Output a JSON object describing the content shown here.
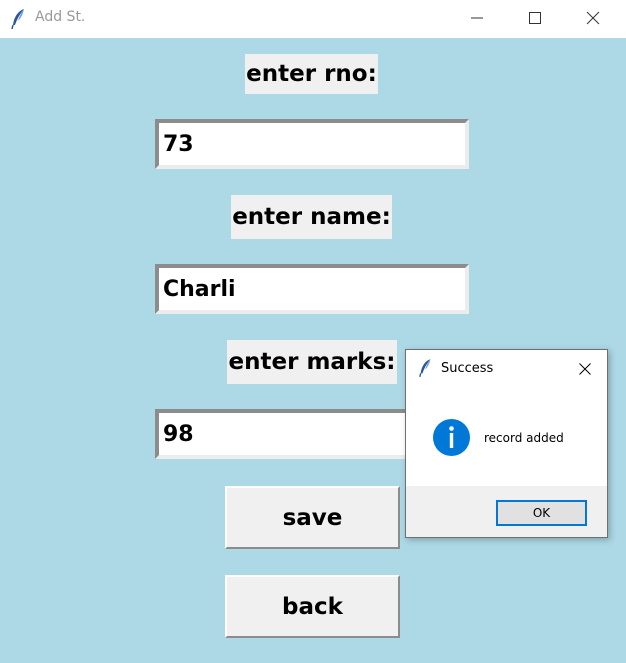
{
  "window": {
    "title": "Add St.",
    "icon": "feather-icon"
  },
  "form": {
    "rno_label": "enter rno:",
    "rno_value": "73",
    "name_label": "enter name:",
    "name_value": "Charli",
    "marks_label": "enter marks:",
    "marks_value": "98",
    "save_label": "save",
    "back_label": "back"
  },
  "dialog": {
    "title": "Success",
    "icon": "info-icon",
    "message": "record added",
    "ok_label": "OK"
  },
  "colors": {
    "background": "#add8e6",
    "label_bg": "#f0f0f0",
    "info_blue": "#0078d7"
  }
}
